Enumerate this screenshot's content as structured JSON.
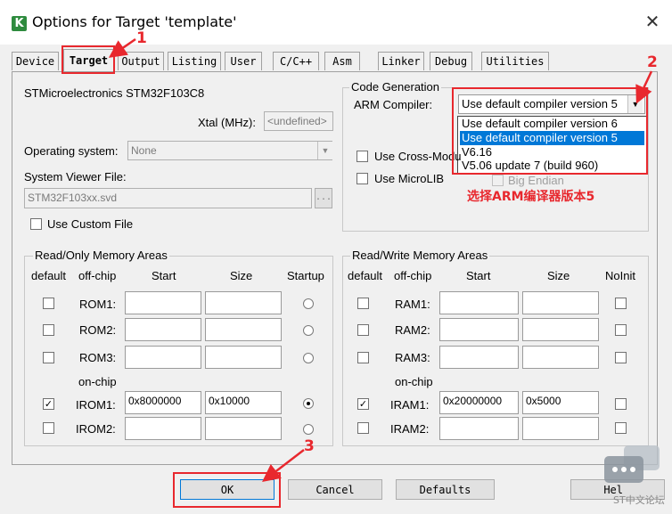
{
  "window": {
    "title": "Options for Target 'template'",
    "close_glyph": "✕"
  },
  "tabs": [
    {
      "label": "Device"
    },
    {
      "label": "Target"
    },
    {
      "label": "Output"
    },
    {
      "label": "Listing"
    },
    {
      "label": "User"
    },
    {
      "label": "C/C++"
    },
    {
      "label": "Asm"
    },
    {
      "label": "Linker"
    },
    {
      "label": "Debug"
    },
    {
      "label": "Utilities"
    }
  ],
  "target": {
    "device_name": "STMicroelectronics STM32F103C8",
    "xtal_label": "Xtal (MHz):",
    "xtal_value": "<undefined>",
    "os_label": "Operating system:",
    "os_value": "None",
    "svf_label": "System Viewer File:",
    "svf_value": "STM32F103xx.svd",
    "svf_browse": "...",
    "custom_file_label": "Use Custom File"
  },
  "codegen": {
    "group_title": "Code Generation",
    "compiler_label": "ARM Compiler:",
    "compiler_value": "Use default compiler version 5",
    "options": [
      {
        "label": "Use default compiler version 6",
        "selected": false
      },
      {
        "label": "Use default compiler version 5",
        "selected": true
      },
      {
        "label": "V6.16",
        "selected": false
      },
      {
        "label": "V5.06 update 7 (build 960)",
        "selected": false
      }
    ],
    "cross_module_label": "Use Cross-Modu",
    "microlib_label": "Use MicroLIB",
    "big_endian_label": "Big Endian"
  },
  "ro_memory": {
    "title": "Read/Only Memory Areas",
    "headers": {
      "default": "default",
      "offchip": "off-chip",
      "start": "Start",
      "size": "Size",
      "startup": "Startup"
    },
    "onchip_label": "on-chip",
    "rows": [
      {
        "name": "ROM1:",
        "start": "",
        "size": "",
        "default": false,
        "startup": false
      },
      {
        "name": "ROM2:",
        "start": "",
        "size": "",
        "default": false,
        "startup": false
      },
      {
        "name": "ROM3:",
        "start": "",
        "size": "",
        "default": false,
        "startup": false
      },
      {
        "name": "IROM1:",
        "start": "0x8000000",
        "size": "0x10000",
        "default": true,
        "startup": true
      },
      {
        "name": "IROM2:",
        "start": "",
        "size": "",
        "default": false,
        "startup": false
      }
    ]
  },
  "rw_memory": {
    "title": "Read/Write Memory Areas",
    "headers": {
      "default": "default",
      "offchip": "off-chip",
      "start": "Start",
      "size": "Size",
      "noinit": "NoInit"
    },
    "onchip_label": "on-chip",
    "rows": [
      {
        "name": "RAM1:",
        "start": "",
        "size": "",
        "default": false,
        "noinit": false
      },
      {
        "name": "RAM2:",
        "start": "",
        "size": "",
        "default": false,
        "noinit": false
      },
      {
        "name": "RAM3:",
        "start": "",
        "size": "",
        "default": false,
        "noinit": false
      },
      {
        "name": "IRAM1:",
        "start": "0x20000000",
        "size": "0x5000",
        "default": true,
        "noinit": false
      },
      {
        "name": "IRAM2:",
        "start": "",
        "size": "",
        "default": false,
        "noinit": false
      }
    ]
  },
  "buttons": {
    "ok": "OK",
    "cancel": "Cancel",
    "defaults": "Defaults",
    "help": "Hel"
  },
  "annotations": {
    "step1": "1",
    "step2": "2",
    "step3": "3",
    "note": "选择ARM编译器版本5",
    "color": "#e8282e"
  },
  "watermark": "ST中文论坛"
}
